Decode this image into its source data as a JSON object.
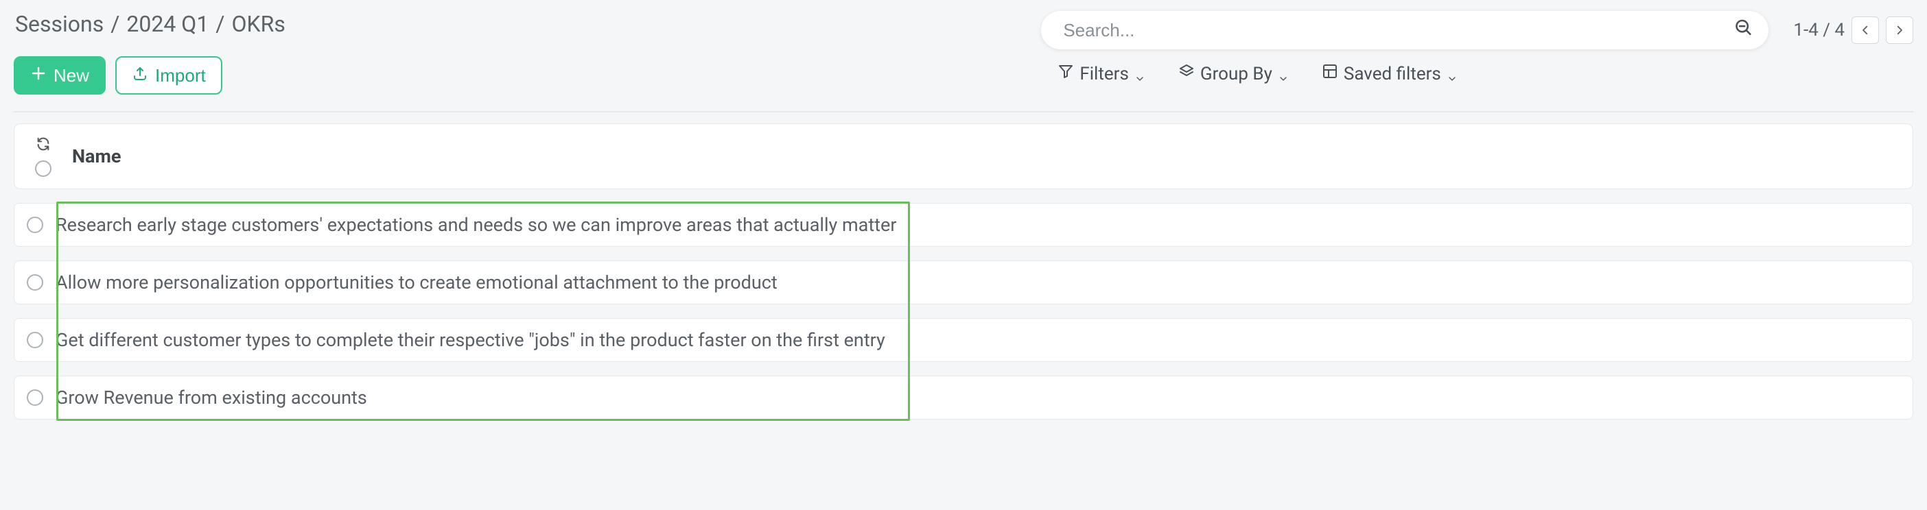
{
  "breadcrumb": {
    "s0": "Sessions",
    "s1": "2024 Q1",
    "s2": "OKRs"
  },
  "actions": {
    "new": "New",
    "import": "Import"
  },
  "search": {
    "placeholder": "Search..."
  },
  "pager": {
    "label": "1-4 / 4"
  },
  "filters": {
    "filters": "Filters",
    "groupby": "Group By",
    "saved": "Saved filters"
  },
  "columns": {
    "name": "Name"
  },
  "rows": [
    {
      "name": "Research early stage customers' expectations and needs so we can improve areas that actually matter"
    },
    {
      "name": "Allow more personalization opportunities to create emotional attachment to the product"
    },
    {
      "name": "Get different customer types to complete their respective \"jobs\" in the product faster on the first entry"
    },
    {
      "name": "Grow Revenue from existing accounts"
    }
  ]
}
